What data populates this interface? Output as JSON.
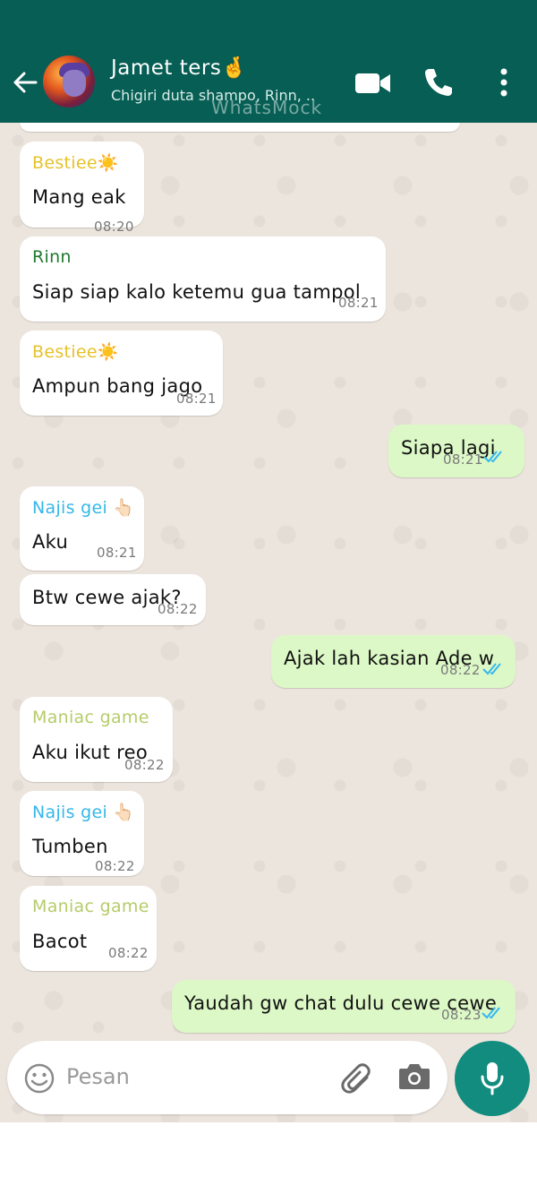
{
  "header": {
    "title": "Jamet ters🤞",
    "subtitle": "Chigiri duta shampo, Rinn, ..",
    "watermark": "WhatsMock"
  },
  "messages": [
    {
      "direction": "in",
      "sender": "Bestiee☀️",
      "sender_color": "#e6c229",
      "text": "Mang eak",
      "time": "08:20"
    },
    {
      "direction": "in",
      "sender": "Rinn",
      "sender_color": "#1f7a2e",
      "text": "Siap siap kalo ketemu gua tampol",
      "time": "08:21"
    },
    {
      "direction": "in",
      "sender": "Bestiee☀️",
      "sender_color": "#e6c229",
      "text": "Ampun bang jago",
      "time": "08:21"
    },
    {
      "direction": "out",
      "text": "Siapa lagi",
      "time": "08:21",
      "status": "read"
    },
    {
      "direction": "in",
      "sender": "Najis gei 👆🏻",
      "sender_color": "#35b7e8",
      "text": "Aku",
      "time": "08:21"
    },
    {
      "direction": "in",
      "text": "Btw cewe ajak?",
      "time": "08:22"
    },
    {
      "direction": "out",
      "text": "Ajak lah kasian Ade w",
      "time": "08:22",
      "status": "read"
    },
    {
      "direction": "in",
      "sender": "Maniac game",
      "sender_color": "#b5cc6a",
      "text": "Aku ikut reo",
      "time": "08:22"
    },
    {
      "direction": "in",
      "sender": "Najis gei 👆🏻",
      "sender_color": "#35b7e8",
      "text": "Tumben",
      "time": "08:22"
    },
    {
      "direction": "in",
      "sender": "Maniac game",
      "sender_color": "#b5cc6a",
      "text": "Bacot",
      "time": "08:22"
    },
    {
      "direction": "out",
      "text": "Yaudah gw chat dulu cewe cewe",
      "time": "08:23",
      "status": "read"
    }
  ],
  "input": {
    "placeholder": "Pesan"
  },
  "colors": {
    "header": "#075e54",
    "outgoing_bubble": "#dcf8c6",
    "incoming_bubble": "#ffffff",
    "read_ticks": "#34b7f1",
    "mic_button": "#128c7e"
  },
  "icons": [
    "back-arrow-icon",
    "video-call-icon",
    "voice-call-icon",
    "more-options-icon",
    "emoji-icon",
    "attach-icon",
    "camera-icon",
    "mic-icon"
  ]
}
